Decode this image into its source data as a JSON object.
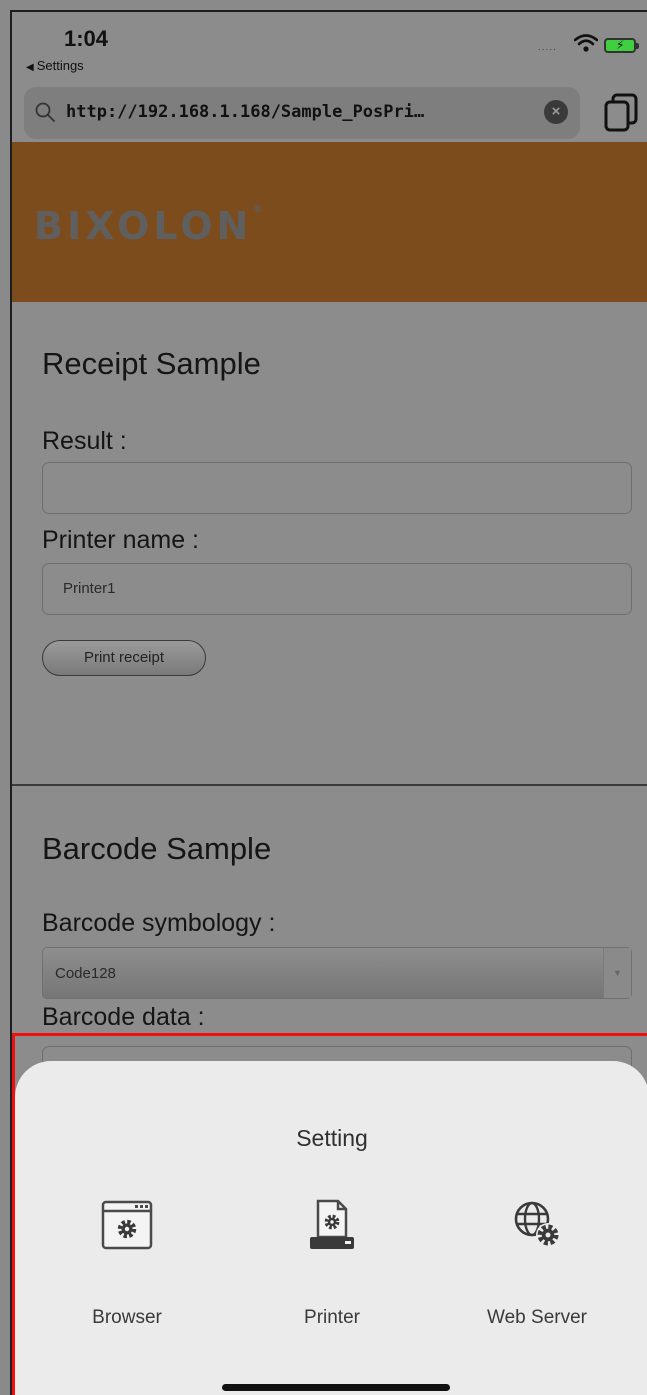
{
  "status_bar": {
    "time": "1:04",
    "back_label": "Settings",
    "signal_dots": "....."
  },
  "browser": {
    "url": "http://192.168.1.168/Sample_PosPri…"
  },
  "brand": {
    "logo": "BIXOLON",
    "mark": "®"
  },
  "receipt_section": {
    "title": "Receipt Sample",
    "result_label": "Result :",
    "result_value": "",
    "printer_name_label": "Printer name :",
    "printer_name_value": "Printer1",
    "print_button": "Print receipt"
  },
  "barcode_section": {
    "title": "Barcode Sample",
    "symbology_label": "Barcode symbology :",
    "symbology_value": "Code128",
    "data_label": "Barcode data :"
  },
  "setting_sheet": {
    "title": "Setting",
    "options": [
      {
        "label": "Browser",
        "icon": "browser-settings-icon"
      },
      {
        "label": "Printer",
        "icon": "printer-settings-icon"
      },
      {
        "label": "Web Server",
        "icon": "web-server-settings-icon"
      }
    ]
  },
  "colors": {
    "brand_bar": "#7c4c1c",
    "overlay_gray": "#8c8c8c",
    "sheet_bg": "#ebebeb",
    "highlight": "#ee1111",
    "battery": "#3fcf3f"
  }
}
